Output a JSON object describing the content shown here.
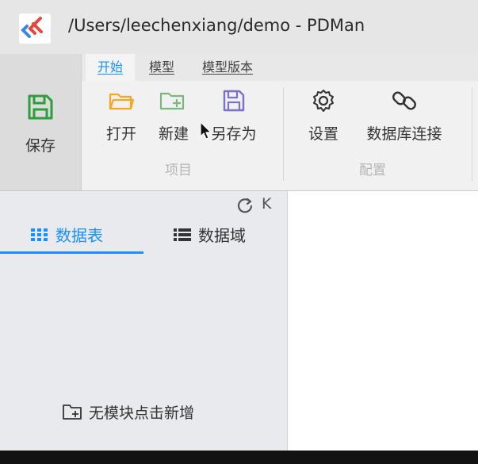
{
  "window": {
    "title": "/Users/leechenxiang/demo - PDMan",
    "logo_icon": "pdman-logo-icon"
  },
  "tabs": [
    {
      "label": "开始",
      "active": true
    },
    {
      "label": "模型",
      "active": false
    },
    {
      "label": "模型版本",
      "active": false
    }
  ],
  "ribbon": {
    "save": {
      "label": "保存",
      "icon": "save-icon",
      "color": "#2e9d3a"
    },
    "project_group": {
      "label": "项目",
      "buttons": [
        {
          "label": "打开",
          "icon": "folder-open-icon",
          "color": "#f5a623"
        },
        {
          "label": "新建",
          "icon": "folder-add-icon",
          "color": "#7cb87c"
        },
        {
          "label": "另存为",
          "icon": "save-as-icon",
          "color": "#7a72c9"
        }
      ]
    },
    "config_group": {
      "label": "配置",
      "buttons": [
        {
          "label": "设置",
          "icon": "gear-icon"
        },
        {
          "label": "数据库连接",
          "icon": "link-icon"
        }
      ]
    }
  },
  "left_panel": {
    "tabs": [
      {
        "label": "数据表",
        "icon": "grid-icon",
        "active": true
      },
      {
        "label": "数据域",
        "icon": "list-icon",
        "active": false
      }
    ],
    "collapse_label": "K",
    "empty_hint": "无模块点击新增"
  },
  "colors": {
    "accent": "#1890ff"
  }
}
